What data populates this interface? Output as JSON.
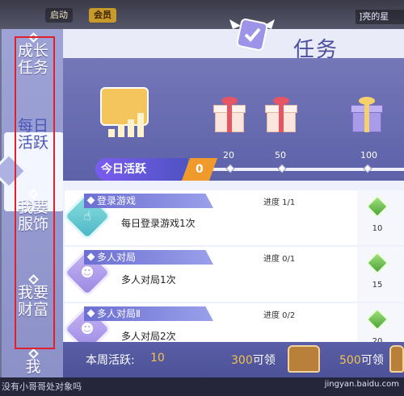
{
  "topbar": {
    "chip_start": "启动",
    "chip_vip": "会员",
    "right_text": "]亮的星"
  },
  "sidebar": {
    "items": [
      {
        "label": "成长任务"
      },
      {
        "label": "每日活跃"
      },
      {
        "label": "我要服饰"
      },
      {
        "label": "我要财富"
      },
      {
        "label": "我"
      }
    ]
  },
  "header": {
    "title": "任务"
  },
  "today_activity": {
    "label": "今日活跃",
    "value": "0"
  },
  "milestones": [
    "20",
    "50",
    "100"
  ],
  "tasks": [
    {
      "header": "登录游戏",
      "progress": "进度 1/1",
      "desc": "每日登录游戏1次",
      "reward": "10"
    },
    {
      "header": "多人对局",
      "progress": "进度 0/1",
      "desc": "多人对局1次",
      "reward": "15"
    },
    {
      "header": "多人对局Ⅱ",
      "progress": "进度 0/2",
      "desc": "多人对局2次",
      "reward": "20"
    }
  ],
  "weekly": {
    "label": "本周活跃:",
    "value": "10",
    "m1_num": "300",
    "m1_text": "可领",
    "m2_num": "500",
    "m2_text": "可领"
  },
  "bottom": {
    "chat": "没有小哥哥处对象吗",
    "watermark": "jingyan.baidu.com"
  }
}
